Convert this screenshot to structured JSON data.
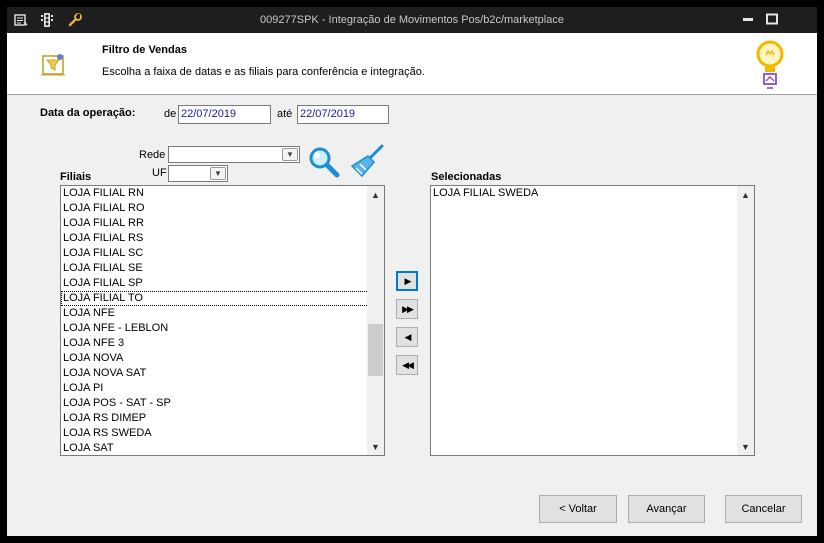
{
  "window": {
    "title": "009277SPK - Integração de Movimentos Pos/b2c/marketplace"
  },
  "header": {
    "title": "Filtro de Vendas",
    "subtitle": "Escolha a faixa de datas e as filiais para conferência e integração."
  },
  "date_filter": {
    "label": "Data da operação:",
    "from_label": "de",
    "from_value": "22/07/2019",
    "to_label": "até",
    "to_value": "22/07/2019"
  },
  "filters": {
    "rede_label": "Rede",
    "rede_value": "",
    "uf_label": "UF",
    "uf_value": ""
  },
  "filiais": {
    "label": "Filiais",
    "items": [
      "LOJA FILIAL RN",
      "LOJA FILIAL RO",
      "LOJA FILIAL RR",
      "LOJA FILIAL RS",
      "LOJA FILIAL SC",
      "LOJA FILIAL SE",
      "LOJA FILIAL SP",
      "LOJA FILIAL TO",
      "LOJA NFE",
      "LOJA NFE - LEBLON",
      "LOJA NFE 3",
      "LOJA NOVA",
      "LOJA NOVA SAT",
      "LOJA PI",
      "LOJA POS - SAT - SP",
      "LOJA RS DIMEP",
      "LOJA RS SWEDA",
      "LOJA SAT"
    ],
    "focused_index": 7
  },
  "selecionadas": {
    "label": "Selecionadas",
    "items": [
      "LOJA FILIAL SWEDA"
    ]
  },
  "footer": {
    "back_label": "< Voltar",
    "next_label": "Avançar",
    "cancel_label": "Cancelar"
  },
  "colors": {
    "titlebar": "#1e1e1e",
    "client_bg": "#f0f0f0",
    "input_text": "#1a1aa6",
    "accent": "#0078d7"
  }
}
